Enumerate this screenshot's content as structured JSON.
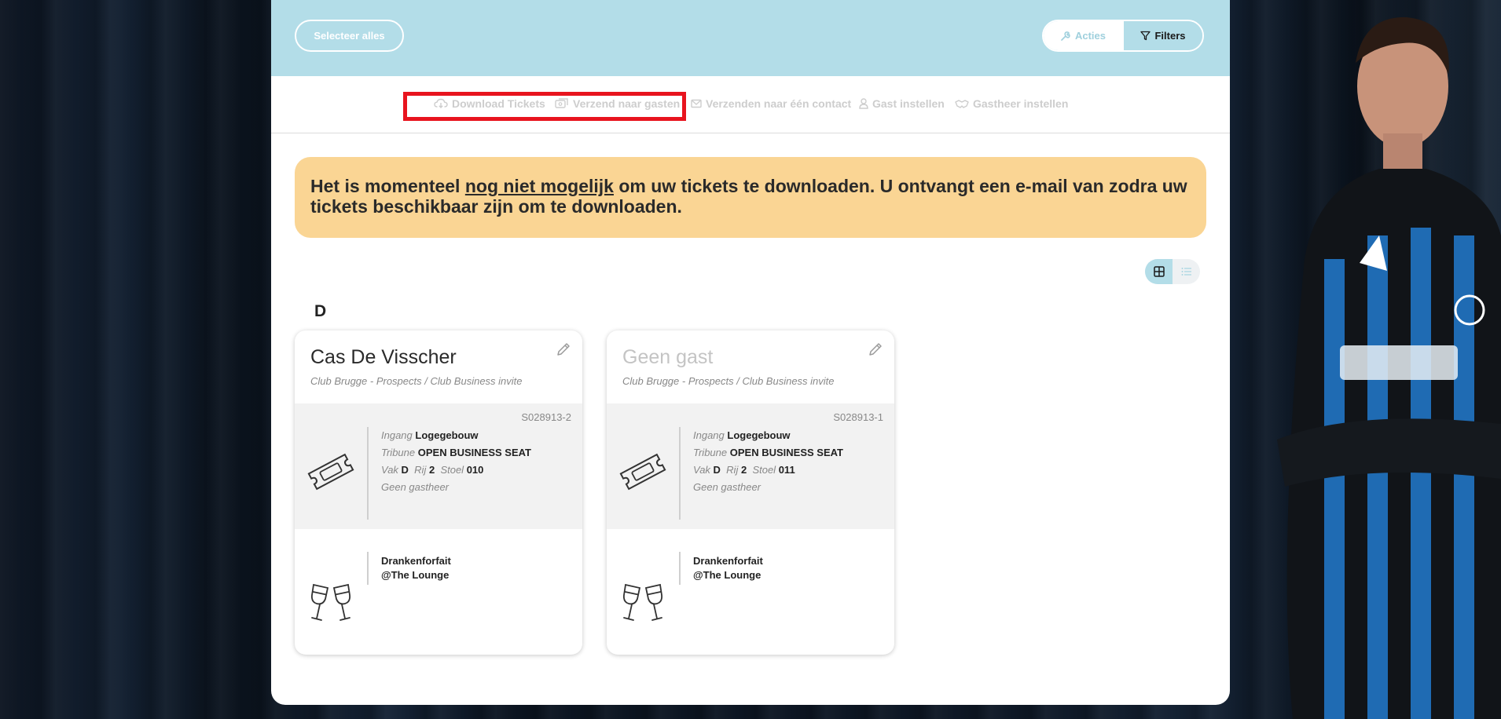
{
  "toolbar": {
    "select_all": "Selecteer alles",
    "acties": "Acties",
    "filters": "Filters"
  },
  "actions": {
    "download": "Download Tickets",
    "send_guests": "Verzend naar gasten",
    "send_contact": "Verzenden naar één contact",
    "set_guest": "Gast instellen",
    "set_host": "Gastheer instellen"
  },
  "notice": {
    "before": "Het is momenteel ",
    "underlined": "nog niet mogelijk",
    "after": " om uw tickets te downloaden. U ontvangt een e-mail van zodra uw tickets beschikbaar zijn om te downloaden."
  },
  "group_letter": "D",
  "labels": {
    "ingang": "Ingang",
    "tribune": "Tribune",
    "vak": "Vak",
    "rij": "Rij",
    "stoel": "Stoel"
  },
  "cards": [
    {
      "name": "Cas De Visscher",
      "subtitle": "Club Brugge - Prospects / Club Business invite",
      "code": "S028913-2",
      "ingang": "Logegebouw",
      "tribune": "OPEN BUSINESS SEAT",
      "vak": "D",
      "rij": "2",
      "stoel": "010",
      "host": "Geen gastheer",
      "extra_line1": "Drankenforfait",
      "extra_line2": "@The Lounge"
    },
    {
      "name": "Geen gast",
      "subtitle": "Club Brugge - Prospects / Club Business invite",
      "code": "S028913-1",
      "ingang": "Logegebouw",
      "tribune": "OPEN BUSINESS SEAT",
      "vak": "D",
      "rij": "2",
      "stoel": "011",
      "host": "Geen gastheer",
      "extra_line1": "Drankenforfait",
      "extra_line2": "@The Lounge"
    }
  ],
  "colors": {
    "topbar": "#b3dde8",
    "notice": "#fad594",
    "highlight": "#e8141e"
  }
}
